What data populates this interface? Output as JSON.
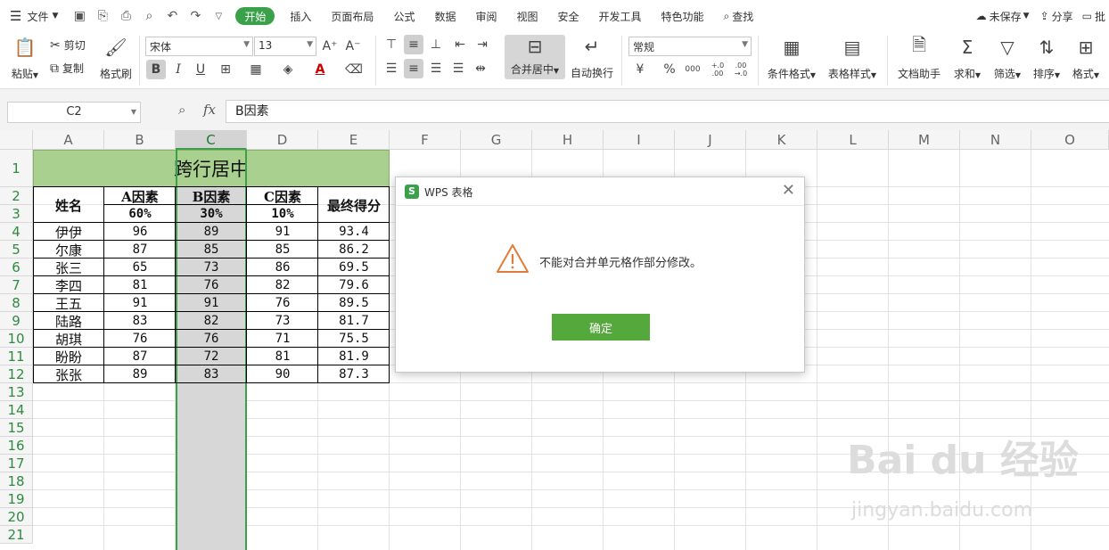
{
  "menubar": {
    "file": "文件",
    "tabs": [
      "开始",
      "插入",
      "页面布局",
      "公式",
      "数据",
      "审阅",
      "视图",
      "安全",
      "开发工具",
      "特色功能"
    ],
    "search": "查找",
    "unsaved": "未保存",
    "share": "分享",
    "batch": "批"
  },
  "ribbon": {
    "paste": "粘贴",
    "cut": "剪切",
    "copy": "复制",
    "format_painter": "格式刷",
    "font_name": "宋体",
    "font_size": "13",
    "merge_center": "合并居中",
    "auto_wrap": "自动换行",
    "number_format": "常规",
    "cond_format": "条件格式",
    "table_style": "表格样式",
    "doc_assistant": "文档助手",
    "sum": "求和",
    "filter": "筛选",
    "sort": "排序",
    "format": "格式",
    "bold_icon": "B",
    "italic_icon": "I",
    "underline_icon": "U",
    "font_grow": "A⁺",
    "font_shrink": "A⁻",
    "currency": "¥",
    "percent": "%",
    "thousands": "000",
    "inc_decimal": "+.0 .00",
    "dec_decimal": ".00 →.0"
  },
  "formula_bar": {
    "name_box": "C2",
    "fx": "fx",
    "content": "B因素"
  },
  "columns": [
    "A",
    "B",
    "C",
    "D",
    "E",
    "F",
    "G",
    "H",
    "I",
    "J",
    "K",
    "L",
    "M",
    "N",
    "O"
  ],
  "rows": [
    "1",
    "2",
    "3",
    "4",
    "5",
    "6",
    "7",
    "8",
    "9",
    "10",
    "11",
    "12",
    "13",
    "14",
    "15",
    "16",
    "17",
    "18",
    "19",
    "20",
    "21"
  ],
  "sheet": {
    "title": "跨行居中",
    "header_name": "姓名",
    "header_a": "A因素",
    "header_b": "B因素",
    "header_c": "C因素",
    "header_final": "最终得分",
    "weight_a": "60%",
    "weight_b": "30%",
    "weight_c": "10%",
    "data": [
      [
        "伊伊",
        "96",
        "89",
        "91",
        "93.4"
      ],
      [
        "尔康",
        "87",
        "85",
        "85",
        "86.2"
      ],
      [
        "张三",
        "65",
        "73",
        "86",
        "69.5"
      ],
      [
        "李四",
        "81",
        "76",
        "82",
        "79.6"
      ],
      [
        "王五",
        "91",
        "91",
        "76",
        "89.5"
      ],
      [
        "陆路",
        "83",
        "82",
        "73",
        "81.7"
      ],
      [
        "胡琪",
        "76",
        "76",
        "71",
        "75.5"
      ],
      [
        "盼盼",
        "87",
        "72",
        "81",
        "81.9"
      ],
      [
        "张张",
        "89",
        "83",
        "90",
        "87.3"
      ]
    ]
  },
  "dialog": {
    "title": "WPS 表格",
    "message": "不能对合并单元格作部分修改。",
    "ok": "确定",
    "logo_letter": "S"
  },
  "watermark": {
    "logo": "Bai du 经验",
    "url": "jingyan.baidu.com"
  },
  "colors": {
    "accent": "#3aa14a",
    "title_fill": "#a9d08e",
    "dialog_button": "#54a83c",
    "warning": "#e07b39"
  }
}
